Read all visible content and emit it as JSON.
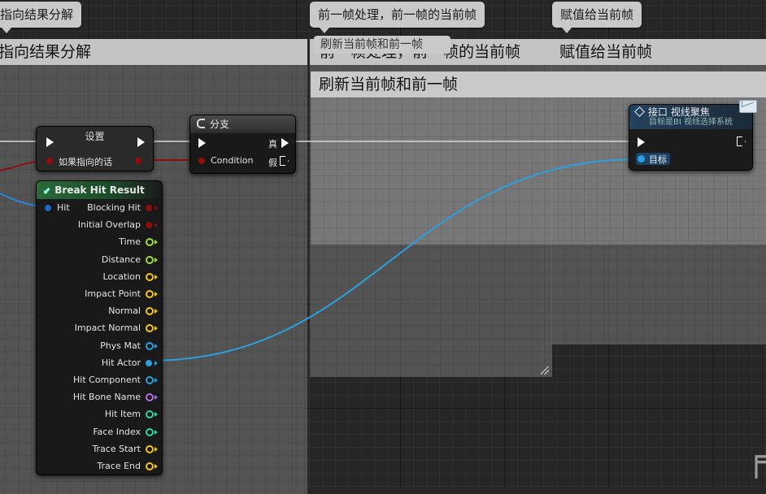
{
  "comments": {
    "left_title": "指向结果分解",
    "left_bubble": "指向结果分解",
    "middle_title": "前一帧处理，前一帧的当前帧",
    "middle_bubble": "前一帧处理，前一帧的当前帧",
    "inner_title": "刷新当前帧和前一帧",
    "inner_bubble_partial": "刷新当前帧和前一帧",
    "right_title": "赋值给当前帧",
    "right_bubble": "赋值给当前帧"
  },
  "set_node": {
    "title": "设置",
    "pin_label": "如果指向的话"
  },
  "branch_node": {
    "title": "分支",
    "condition": "Condition",
    "true_label": "真",
    "false_label": "假"
  },
  "break_node": {
    "title": "Break Hit Result",
    "input_pin": "Hit",
    "outputs": [
      {
        "label": "Blocking Hit",
        "color": "#8e0e0e",
        "kind": "bool"
      },
      {
        "label": "Initial Overlap",
        "color": "#8e0e0e",
        "kind": "bool"
      },
      {
        "label": "Time",
        "color": "#9be13b",
        "kind": "ring"
      },
      {
        "label": "Distance",
        "color": "#9be13b",
        "kind": "ring"
      },
      {
        "label": "Location",
        "color": "#f5c518",
        "kind": "ring"
      },
      {
        "label": "Impact Point",
        "color": "#f5c518",
        "kind": "ring"
      },
      {
        "label": "Normal",
        "color": "#f5c518",
        "kind": "ring"
      },
      {
        "label": "Impact Normal",
        "color": "#f5c518",
        "kind": "ring"
      },
      {
        "label": "Phys Mat",
        "color": "#2aa0e0",
        "kind": "ring"
      },
      {
        "label": "Hit Actor",
        "color": "#2aa0e0",
        "kind": "filled"
      },
      {
        "label": "Hit Component",
        "color": "#2aa0e0",
        "kind": "ring"
      },
      {
        "label": "Hit Bone Name",
        "color": "#b56ce8",
        "kind": "ring"
      },
      {
        "label": "Hit Item",
        "color": "#2fd6a0",
        "kind": "ring"
      },
      {
        "label": "Face Index",
        "color": "#2fd6a0",
        "kind": "ring"
      },
      {
        "label": "Trace Start",
        "color": "#f5c518",
        "kind": "ring"
      },
      {
        "label": "Trace End",
        "color": "#f5c518",
        "kind": "ring"
      }
    ]
  },
  "interface_node": {
    "title": "接口 视线聚焦",
    "subtitle": "目标是BI 视线选择系统",
    "target_label": "目标"
  },
  "colors": {
    "exec": "#ffffff",
    "bool": "#8e0e0e",
    "object": "#2aa0e0",
    "branch_header": "#3a3a3a",
    "break_header": "#1f5a2e",
    "interface_header": "#1e3b55"
  }
}
